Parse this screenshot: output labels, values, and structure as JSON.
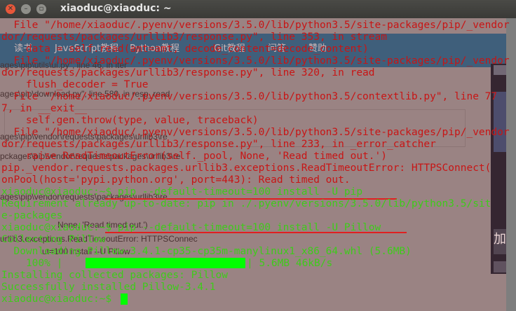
{
  "window": {
    "title": "xiaoduc@xiaoduc: ~"
  },
  "background": {
    "nav": [
      "读书",
      "JavaScript教程",
      "Python教程",
      "Git教程",
      "问答",
      "赞助"
    ],
    "snippets": [
      "ages\\pip\\utils\\ui.py\", line 46, in iter",
      "ages\\pip\\download.py\", line 580, in resp_read",
      "ages\\pip\\vendor\\requests\\packages\\urllib3\\re",
      "pckages\\pip\\vendor\\requests\\packages\\urllib3\\re",
      "ages\\pip\\vendor\\requests\\packages\\urllib3\\re",
      "None, 'Read timed out.')",
      "urllib3.exceptions.ReadTimeoutError: HTTPSConnec",
      "ut=100 install --U Pillow"
    ],
    "panel_char": "加"
  },
  "terminal": {
    "lines": [
      {
        "text": "  File \"/home/xiaoduc/.pyenv/versions/3.5.0/lib/python3.5/site-packages/pip/_vendor",
        "color": "red"
      },
      {
        "text": "dor/requests/packages/urllib3/response.py\", line 353, in stream",
        "color": "red"
      },
      {
        "text": "    data = self.read(amt=amt, decode_content=decode_content)",
        "color": "red"
      },
      {
        "text": "  File \"/home/xiaoduc/.pyenv/versions/3.5.0/lib/python3.5/site-packages/pip/_vendor",
        "color": "red"
      },
      {
        "text": "dor/requests/packages/urllib3/response.py\", line 320, in read",
        "color": "red"
      },
      {
        "text": "    flush_decoder = True",
        "color": "red"
      },
      {
        "text": "  File \"/home/xiaoduc/.pyenv/versions/3.5.0/lib/python3.5/contextlib.py\", line 77",
        "color": "red"
      },
      {
        "text": "7, in __exit__",
        "color": "red"
      },
      {
        "text": "    self.gen.throw(type, value, traceback)",
        "color": "red"
      },
      {
        "text": "  File \"/home/xiaoduc/.pyenv/versions/3.5.0/lib/python3.5/site-packages/pip/_vendor",
        "color": "red"
      },
      {
        "text": "dor/requests/packages/urllib3/response.py\", line 233, in _error_catcher",
        "color": "red"
      },
      {
        "text": "    raise ReadTimeoutError(self._pool, None, 'Read timed out.')",
        "color": "red"
      },
      {
        "text": "pip._vendor.requests.packages.urllib3.exceptions.ReadTimeoutError: HTTPSConnect(",
        "color": "red"
      },
      {
        "text": "onPool(host='pypi.python.org', port=443): Read timed out.",
        "color": "red"
      },
      {
        "text": "xiaoduc@xiaoduc:~$ pip --default-timeout=100 install -U pip",
        "color": "green"
      },
      {
        "text": "Requirement already up-to-date: pip in ./.pyenv/versions/3.5.0/lib/python3.5/sit",
        "color": "green"
      },
      {
        "text": "e-packages",
        "color": "green"
      },
      {
        "text": "xiaoduc@xiaoduc:~$ pip --default-timeout=100 install -U Pillow",
        "color": "green"
      },
      {
        "text": "Collecting Pillow",
        "color": "green"
      },
      {
        "text": "  Downloading Pillow-3.4.1-cp35-cp35m-manylinux1_x86_64.whl (5.6MB)",
        "color": "green"
      },
      {
        "text": "    100% |",
        "color": "green"
      },
      {
        "text": "Installing collected packages: Pillow",
        "color": "green"
      },
      {
        "text": "Successfully installed Pillow-3.4.1",
        "color": "green"
      },
      {
        "text": "xiaoduc@xiaoduc:~$ ",
        "color": "green"
      }
    ],
    "progress": {
      "percent": 100,
      "label": "| 5.6MB 46kB/s"
    }
  }
}
